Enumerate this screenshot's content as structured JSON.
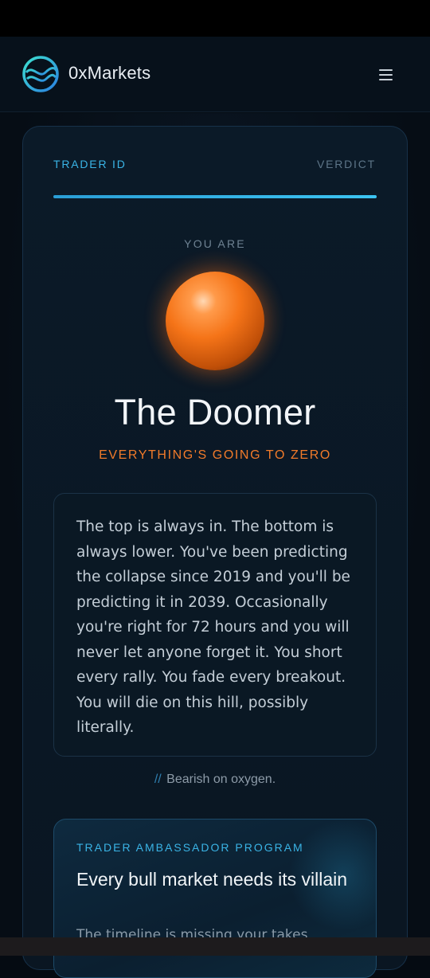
{
  "app": {
    "brand": "0xMarkets"
  },
  "tabs": {
    "left": "TRADER ID",
    "right": "VERDICT",
    "progress_fraction": 1.0
  },
  "result": {
    "you_are": "YOU ARE",
    "title": "The Doomer",
    "subtitle": "EVERYTHING'S GOING TO ZERO",
    "description": "The top is always in. The bottom is always lower. You've been predicting the collapse since 2019 and you'll be predicting it in 2039. Occasionally you're right for 72 hours and you will never let anyone forget it. You short every rally. You fade every breakout. You will die on this hill, possibly literally.",
    "tagline_prefix": "//",
    "tagline": "Bearish on oxygen."
  },
  "promo": {
    "label": "TRADER AMBASSADOR PROGRAM",
    "title": "Every bull market needs its villain",
    "text": "The timeline is missing your takes"
  },
  "colors": {
    "accent": "#3ab4e6",
    "orange": "#f07a2a",
    "background": "#050b12"
  },
  "icons": {
    "logo": "globe-wave-logo",
    "menu": "hamburger-menu-icon",
    "orb": "orange-sphere"
  }
}
